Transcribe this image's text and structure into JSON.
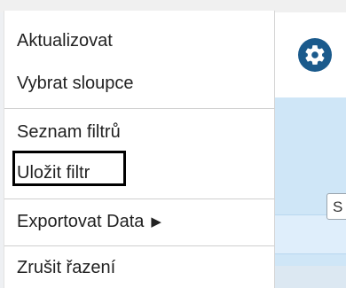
{
  "menu": {
    "items": [
      {
        "label": "Aktualizovat"
      },
      {
        "label": "Vybrat sloupce"
      },
      {
        "label": "Seznam filtrů"
      },
      {
        "label": "Uložit filtr"
      },
      {
        "label": "Exportovat Data"
      },
      {
        "label": "Zrušit řazení"
      }
    ],
    "submenu_arrow": "▶"
  },
  "background": {
    "tooltip_text": "S",
    "gear_icon": "gear-icon",
    "accent_color": "#1a5a8c"
  }
}
